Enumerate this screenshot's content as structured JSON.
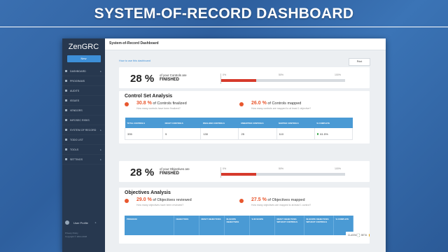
{
  "slide": {
    "title": "SYSTEM-OF-RECORD DASHBOARD"
  },
  "sidebar": {
    "logo": "ZenGRC",
    "new_button": "New",
    "items": [
      {
        "label": "DASHBOARD",
        "icon": "grid-icon",
        "has_chevron": true
      },
      {
        "label": "PROGRAMS",
        "icon": "folder-icon",
        "has_chevron": false
      },
      {
        "label": "AUDITS",
        "icon": "clipboard-icon",
        "has_chevron": false
      },
      {
        "label": "ISSUES",
        "icon": "alert-icon",
        "has_chevron": false
      },
      {
        "label": "VENDORS",
        "icon": "briefcase-icon",
        "has_chevron": false
      },
      {
        "label": "INFOSEC RISKS",
        "icon": "shield-icon",
        "has_chevron": false
      },
      {
        "label": "SYSTEM OF RECORD",
        "icon": "database-icon",
        "has_chevron": true
      },
      {
        "label": "TODO LIST",
        "icon": "checklist-icon",
        "has_chevron": false
      },
      {
        "label": "TOOLS",
        "icon": "wrench-icon",
        "has_chevron": true
      },
      {
        "label": "SETTINGS",
        "icon": "gear-icon",
        "has_chevron": true
      }
    ],
    "user_label": "User Profile",
    "footer_line1": "Privacy Policy",
    "footer_line2": "Copyright © 2014-2018"
  },
  "header": {
    "page_title": "System-of-Record Dashboard"
  },
  "toolbar": {
    "how_to_link": "How to use this dashboard",
    "print_label": "Print"
  },
  "controls_summary": {
    "percent": "28 %",
    "of_text": "of your Controls are",
    "finished": "FINISHED",
    "scale": [
      "0%",
      "50%",
      "100%"
    ],
    "progress": 0.28
  },
  "control_analysis": {
    "title": "Control Set Analysis",
    "stat1": {
      "pct": "30.8 %",
      "text": "of Controls finalized",
      "sub": "How many controls have been finalized?"
    },
    "stat2": {
      "pct": "26.0 %",
      "text": "of Controls mapped",
      "sub": "How many controls are mapped to at least 1 objective?"
    },
    "table": {
      "headers": [
        "TOTAL CONTROLS",
        "DRAFT CONTROLS",
        "FINALIZED CONTROLS",
        "UNMAPPED CONTROLS",
        "MAPPED CONTROLS",
        "% COMPLETE"
      ],
      "row": [
        "335",
        "5",
        "130",
        "25",
        "110",
        "61.5%"
      ]
    }
  },
  "objectives_summary": {
    "percent": "28 %",
    "of_text": "of your Objectives are",
    "finished": "FINISHED",
    "scale": [
      "0%",
      "50%",
      "100%"
    ],
    "progress": 0.28
  },
  "objectives_analysis": {
    "title": "Objectives Analysis",
    "stat1": {
      "pct": "29.0 %",
      "text": "of Objectives reviewed",
      "sub": "How many objectives have been reviewed?"
    },
    "stat2": {
      "pct": "27.5 %",
      "text": "of Objectives mapped",
      "sub": "How many objectives are mapped to at least 1 control?"
    },
    "table": {
      "headers": [
        "PROGRAM",
        "OBJECTIVES",
        "DRAFT OBJECTIVES",
        "IN-SCOPE OBJECTIVES",
        "% IN SCOPE",
        "DRAFT OBJECTIVES WITHOUT CONTROLS",
        "IN-SCOPE OBJECTIVES WITHOUT CONTROLS",
        "% COMPLETE"
      ]
    }
  },
  "mode_toggle": {
    "left": "CLASSIC",
    "right": "BETA"
  },
  "colors": {
    "accent": "#e8572e",
    "progress_fill": "#d63a2c",
    "table_header": "#4a9ad4",
    "sidebar": "#27384f"
  }
}
